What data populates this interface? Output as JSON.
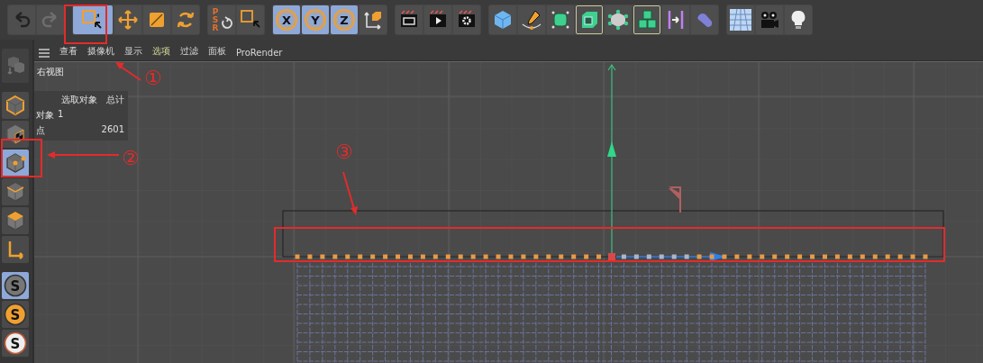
{
  "toolbar": {
    "groups": [
      [
        {
          "kind": "undo",
          "selected": false
        },
        {
          "kind": "redo",
          "selected": false
        }
      ],
      [
        {
          "kind": "live-select",
          "selected": true
        },
        {
          "kind": "move",
          "selected": false
        },
        {
          "kind": "scale",
          "selected": false
        },
        {
          "kind": "rotate",
          "selected": false
        }
      ],
      [
        {
          "kind": "psr",
          "label": "PSR",
          "selected": false
        },
        {
          "kind": "box-select",
          "selected": false
        }
      ],
      [
        {
          "kind": "axis",
          "label": "X",
          "selected": true
        },
        {
          "kind": "axis",
          "label": "Y",
          "selected": true
        },
        {
          "kind": "axis",
          "label": "Z",
          "selected": true
        },
        {
          "kind": "coordinates",
          "selected": false
        }
      ],
      [
        {
          "kind": "render-view",
          "selected": false
        },
        {
          "kind": "render",
          "selected": false
        },
        {
          "kind": "render-settings",
          "selected": false
        }
      ],
      [
        {
          "kind": "cube",
          "selected": false
        },
        {
          "kind": "pen",
          "selected": false
        },
        {
          "kind": "subdivide",
          "selected": false
        },
        {
          "kind": "extrude",
          "selected": false,
          "framed": true
        },
        {
          "kind": "generator",
          "selected": false
        },
        {
          "kind": "cloner",
          "selected": false,
          "framed": true
        },
        {
          "kind": "symmetry",
          "selected": false
        },
        {
          "kind": "bend",
          "selected": false
        }
      ],
      [
        {
          "kind": "floor",
          "selected": false
        },
        {
          "kind": "camera",
          "selected": false
        },
        {
          "kind": "light",
          "selected": false
        }
      ]
    ]
  },
  "sidebar": {
    "items": [
      {
        "kind": "make-editable",
        "selected": false,
        "disabled": true
      },
      {
        "kind": "model",
        "selected": false
      },
      {
        "kind": "texture",
        "selected": false
      },
      {
        "kind": "points",
        "selected": true
      },
      {
        "kind": "edges",
        "selected": false
      },
      {
        "kind": "polygons",
        "selected": false
      },
      {
        "kind": "axis",
        "selected": false
      },
      {
        "kind": "snap",
        "label": "S",
        "selected": true
      },
      {
        "kind": "snap-orange",
        "label": "S",
        "selected": false
      },
      {
        "kind": "snap-white",
        "label": "S",
        "selected": false
      }
    ]
  },
  "menu": {
    "items": [
      {
        "label": "查看",
        "selected": false
      },
      {
        "label": "摄像机",
        "selected": false
      },
      {
        "label": "显示",
        "selected": false
      },
      {
        "label": "选项",
        "selected": true
      },
      {
        "label": "过滤",
        "selected": false
      },
      {
        "label": "面板",
        "selected": false
      },
      {
        "label": "ProRender",
        "selected": false
      }
    ]
  },
  "viewport": {
    "view_name": "右视图",
    "stats": {
      "columns": [
        "选取对象",
        "总计"
      ],
      "rows": [
        {
          "label": "对象",
          "selected": "1"
        },
        {
          "label": "点",
          "total": "2601"
        }
      ]
    }
  },
  "annotations": [
    {
      "number": "①"
    },
    {
      "number": "②"
    },
    {
      "number": "③"
    }
  ]
}
